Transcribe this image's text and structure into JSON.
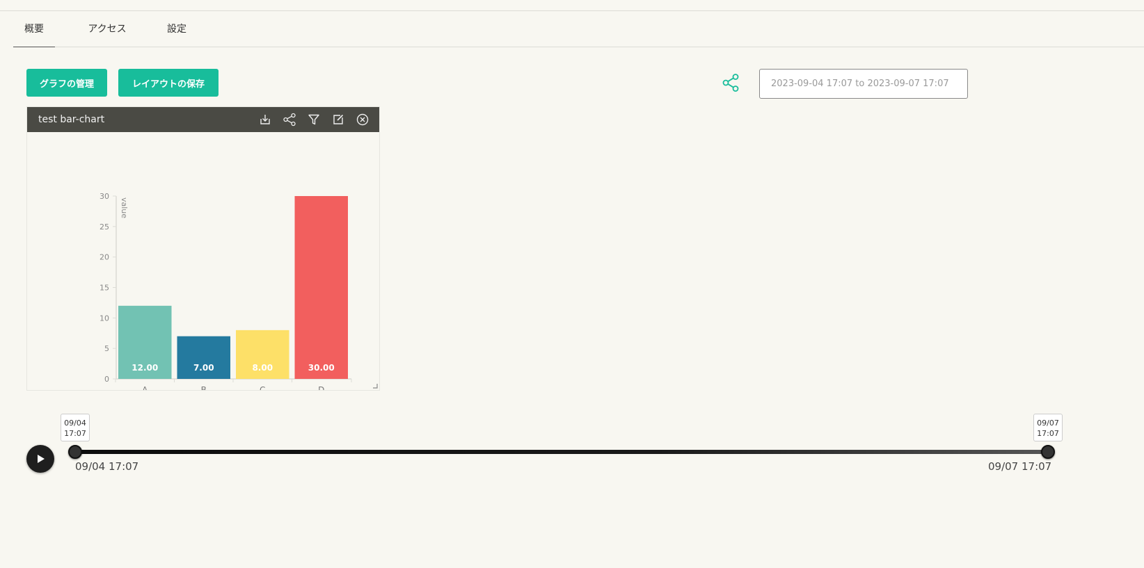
{
  "tabs": [
    {
      "label": "概要",
      "active": true
    },
    {
      "label": "アクセス",
      "active": false
    },
    {
      "label": "設定",
      "active": false
    }
  ],
  "toolbar": {
    "manage_label": "グラフの管理",
    "save_layout_label": "レイアウトの保存",
    "share_icon": "share-icon",
    "date_range_value": "2023-09-04 17:07 to 2023-09-07 17:07"
  },
  "panel": {
    "title": "test bar-chart",
    "actions": [
      "download-icon",
      "share-icon",
      "filter-icon",
      "edit-icon",
      "close-icon"
    ]
  },
  "chart_data": {
    "type": "bar",
    "categories": [
      "A",
      "B",
      "C",
      "D"
    ],
    "values": [
      12,
      7,
      8,
      30
    ],
    "value_labels": [
      "12.00",
      "7.00",
      "8.00",
      "30.00"
    ],
    "colors": [
      "#72c2b3",
      "#247a9f",
      "#fde068",
      "#f25f5e"
    ],
    "ylabel": "value",
    "yticks": [
      "0",
      "5",
      "10",
      "15",
      "20",
      "25",
      "30"
    ],
    "ylim": [
      0,
      30
    ],
    "grid": false
  },
  "timeline": {
    "start_bubble": [
      "09/04",
      "17:07"
    ],
    "end_bubble": [
      "09/07",
      "17:07"
    ],
    "start_label": "09/04 17:07",
    "end_label": "09/07 17:07"
  },
  "colors": {
    "accent": "#18bd9b",
    "background": "#f8f7f1",
    "panel_header": "#4a4a44"
  }
}
